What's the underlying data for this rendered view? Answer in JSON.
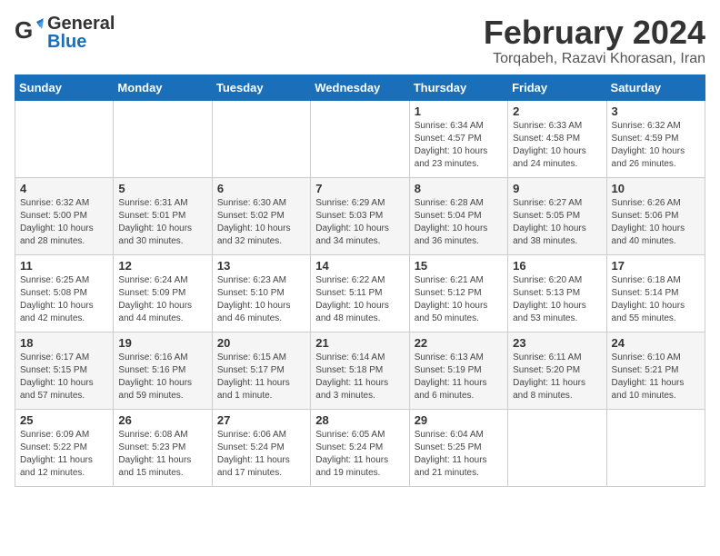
{
  "logo": {
    "line1": "General",
    "line2": "Blue"
  },
  "title": "February 2024",
  "location": "Torqabeh, Razavi Khorasan, Iran",
  "days_header": [
    "Sunday",
    "Monday",
    "Tuesday",
    "Wednesday",
    "Thursday",
    "Friday",
    "Saturday"
  ],
  "weeks": [
    [
      {
        "day": "",
        "info": ""
      },
      {
        "day": "",
        "info": ""
      },
      {
        "day": "",
        "info": ""
      },
      {
        "day": "",
        "info": ""
      },
      {
        "day": "1",
        "info": "Sunrise: 6:34 AM\nSunset: 4:57 PM\nDaylight: 10 hours\nand 23 minutes."
      },
      {
        "day": "2",
        "info": "Sunrise: 6:33 AM\nSunset: 4:58 PM\nDaylight: 10 hours\nand 24 minutes."
      },
      {
        "day": "3",
        "info": "Sunrise: 6:32 AM\nSunset: 4:59 PM\nDaylight: 10 hours\nand 26 minutes."
      }
    ],
    [
      {
        "day": "4",
        "info": "Sunrise: 6:32 AM\nSunset: 5:00 PM\nDaylight: 10 hours\nand 28 minutes."
      },
      {
        "day": "5",
        "info": "Sunrise: 6:31 AM\nSunset: 5:01 PM\nDaylight: 10 hours\nand 30 minutes."
      },
      {
        "day": "6",
        "info": "Sunrise: 6:30 AM\nSunset: 5:02 PM\nDaylight: 10 hours\nand 32 minutes."
      },
      {
        "day": "7",
        "info": "Sunrise: 6:29 AM\nSunset: 5:03 PM\nDaylight: 10 hours\nand 34 minutes."
      },
      {
        "day": "8",
        "info": "Sunrise: 6:28 AM\nSunset: 5:04 PM\nDaylight: 10 hours\nand 36 minutes."
      },
      {
        "day": "9",
        "info": "Sunrise: 6:27 AM\nSunset: 5:05 PM\nDaylight: 10 hours\nand 38 minutes."
      },
      {
        "day": "10",
        "info": "Sunrise: 6:26 AM\nSunset: 5:06 PM\nDaylight: 10 hours\nand 40 minutes."
      }
    ],
    [
      {
        "day": "11",
        "info": "Sunrise: 6:25 AM\nSunset: 5:08 PM\nDaylight: 10 hours\nand 42 minutes."
      },
      {
        "day": "12",
        "info": "Sunrise: 6:24 AM\nSunset: 5:09 PM\nDaylight: 10 hours\nand 44 minutes."
      },
      {
        "day": "13",
        "info": "Sunrise: 6:23 AM\nSunset: 5:10 PM\nDaylight: 10 hours\nand 46 minutes."
      },
      {
        "day": "14",
        "info": "Sunrise: 6:22 AM\nSunset: 5:11 PM\nDaylight: 10 hours\nand 48 minutes."
      },
      {
        "day": "15",
        "info": "Sunrise: 6:21 AM\nSunset: 5:12 PM\nDaylight: 10 hours\nand 50 minutes."
      },
      {
        "day": "16",
        "info": "Sunrise: 6:20 AM\nSunset: 5:13 PM\nDaylight: 10 hours\nand 53 minutes."
      },
      {
        "day": "17",
        "info": "Sunrise: 6:18 AM\nSunset: 5:14 PM\nDaylight: 10 hours\nand 55 minutes."
      }
    ],
    [
      {
        "day": "18",
        "info": "Sunrise: 6:17 AM\nSunset: 5:15 PM\nDaylight: 10 hours\nand 57 minutes."
      },
      {
        "day": "19",
        "info": "Sunrise: 6:16 AM\nSunset: 5:16 PM\nDaylight: 10 hours\nand 59 minutes."
      },
      {
        "day": "20",
        "info": "Sunrise: 6:15 AM\nSunset: 5:17 PM\nDaylight: 11 hours\nand 1 minute."
      },
      {
        "day": "21",
        "info": "Sunrise: 6:14 AM\nSunset: 5:18 PM\nDaylight: 11 hours\nand 3 minutes."
      },
      {
        "day": "22",
        "info": "Sunrise: 6:13 AM\nSunset: 5:19 PM\nDaylight: 11 hours\nand 6 minutes."
      },
      {
        "day": "23",
        "info": "Sunrise: 6:11 AM\nSunset: 5:20 PM\nDaylight: 11 hours\nand 8 minutes."
      },
      {
        "day": "24",
        "info": "Sunrise: 6:10 AM\nSunset: 5:21 PM\nDaylight: 11 hours\nand 10 minutes."
      }
    ],
    [
      {
        "day": "25",
        "info": "Sunrise: 6:09 AM\nSunset: 5:22 PM\nDaylight: 11 hours\nand 12 minutes."
      },
      {
        "day": "26",
        "info": "Sunrise: 6:08 AM\nSunset: 5:23 PM\nDaylight: 11 hours\nand 15 minutes."
      },
      {
        "day": "27",
        "info": "Sunrise: 6:06 AM\nSunset: 5:24 PM\nDaylight: 11 hours\nand 17 minutes."
      },
      {
        "day": "28",
        "info": "Sunrise: 6:05 AM\nSunset: 5:24 PM\nDaylight: 11 hours\nand 19 minutes."
      },
      {
        "day": "29",
        "info": "Sunrise: 6:04 AM\nSunset: 5:25 PM\nDaylight: 11 hours\nand 21 minutes."
      },
      {
        "day": "",
        "info": ""
      },
      {
        "day": "",
        "info": ""
      }
    ]
  ]
}
